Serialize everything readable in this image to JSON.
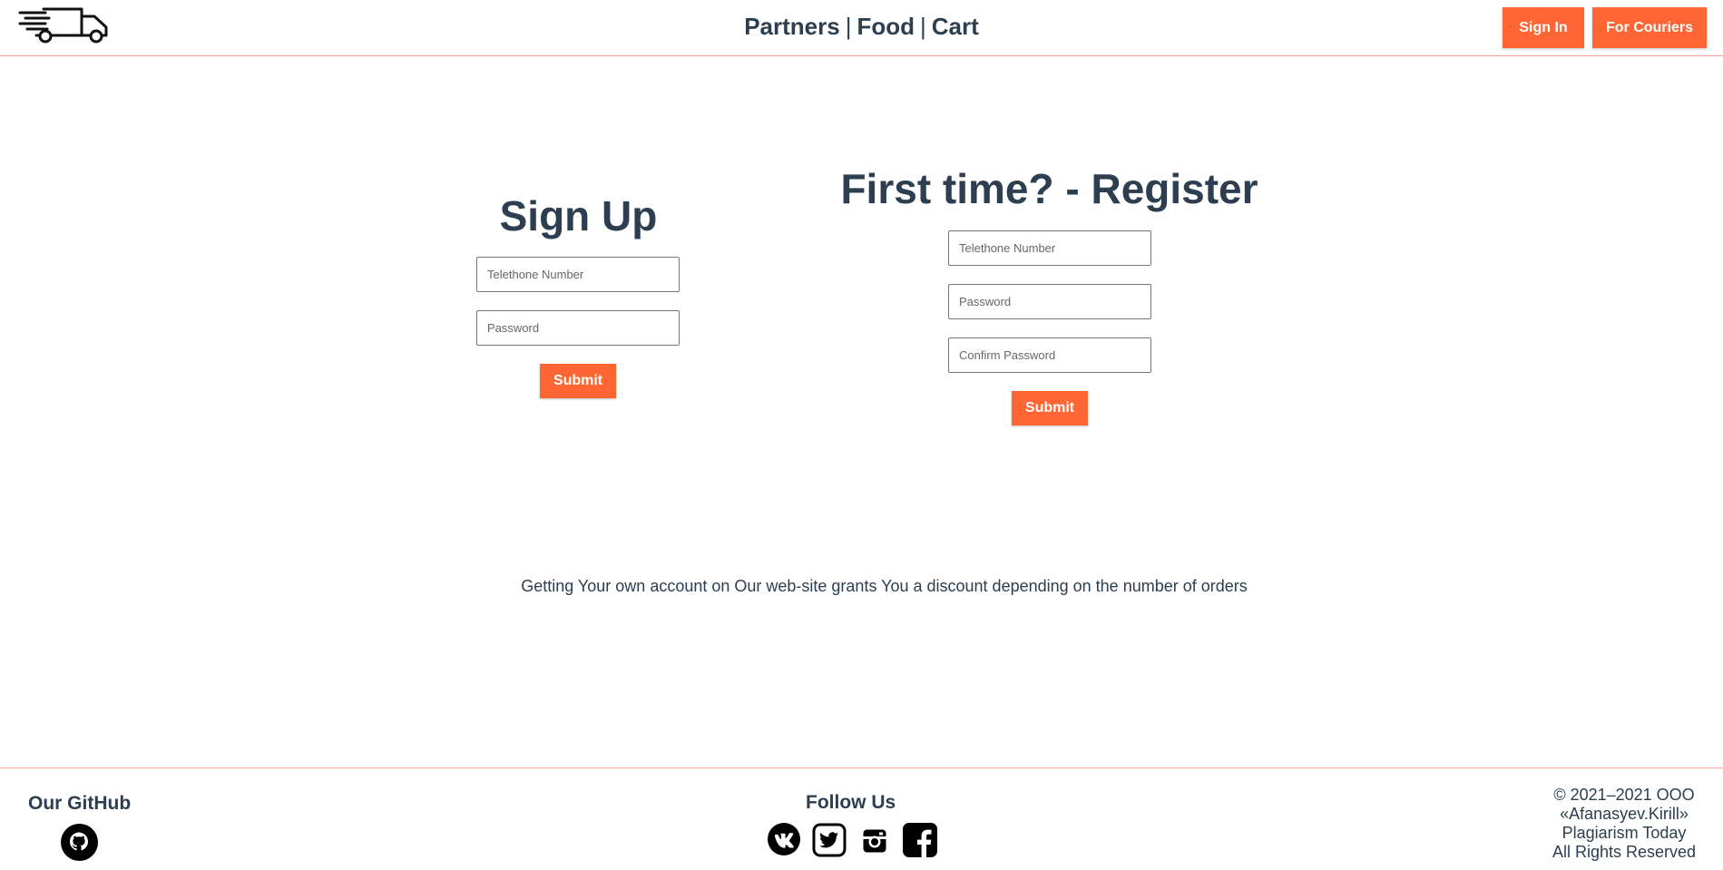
{
  "header": {
    "logo_icon": "delivery-truck-icon",
    "nav": [
      {
        "label": "Partners"
      },
      {
        "label": "Food"
      },
      {
        "label": "Cart"
      }
    ],
    "nav_separator": "|",
    "sign_in_label": "Sign In",
    "couriers_label": "For Couriers"
  },
  "login": {
    "title": "Sign Up",
    "phone_placeholder": "Telethone Number",
    "password_placeholder": "Password",
    "submit_label": "Submit"
  },
  "register": {
    "title": "First time? - Register",
    "phone_placeholder": "Telethone Number",
    "password_placeholder": "Password",
    "confirm_placeholder": "Confirm Password",
    "submit_label": "Submit"
  },
  "info_text": "Getting Your own account on Our web-site grants You a discount depending on the number of orders",
  "footer": {
    "github_title": "Our GitHub",
    "follow_title": "Follow Us",
    "social_icons": [
      "vk-icon",
      "twitter-icon",
      "instagram-icon",
      "facebook-icon"
    ],
    "copyright_lines": [
      "© 2021–2021 ООО",
      "«Afanasyev.Kirill»",
      "Plagiarism Today",
      "All Rights Reserved"
    ]
  },
  "colors": {
    "accent": "#ff6633",
    "text": "#2c3e50",
    "divider": "#f2a58d"
  }
}
